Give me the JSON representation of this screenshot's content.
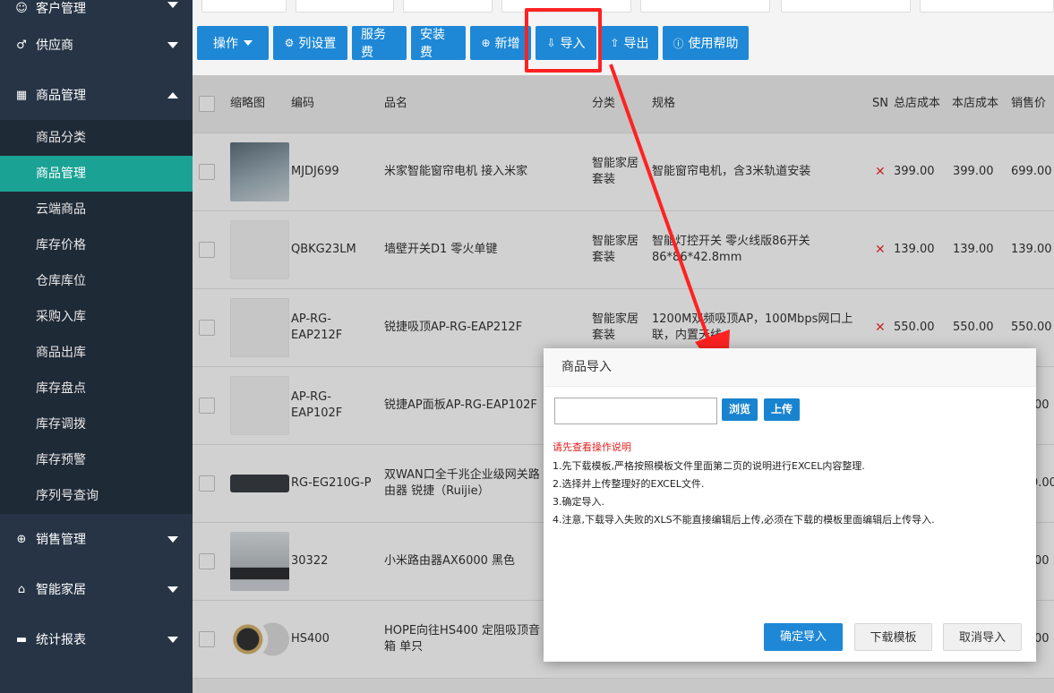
{
  "sidebar": {
    "groups_top": [
      {
        "label": "客户管理",
        "icon": "users-icon"
      },
      {
        "label": "供应商",
        "icon": "supplier-icon"
      }
    ],
    "goods": {
      "label": "商品管理",
      "icon": "gift-icon"
    },
    "sub_items": [
      "商品分类",
      "商品管理",
      "云端商品",
      "库存价格",
      "仓库库位",
      "采购入库",
      "商品出库",
      "库存盘点",
      "库存调拨",
      "库存预警",
      "序列号查询"
    ],
    "groups_bottom": [
      {
        "label": "销售管理",
        "icon": "cart-icon"
      },
      {
        "label": "智能家居",
        "icon": "home-icon"
      },
      {
        "label": "统计报表",
        "icon": "report-icon"
      }
    ]
  },
  "toolbar": {
    "operate": "操作",
    "columns": "列设置",
    "service_fee": "服务费",
    "install_fee": "安装费",
    "add": "新增",
    "import": "导入",
    "export": "导出",
    "help": "使用帮助"
  },
  "table": {
    "headers": {
      "thumb": "缩略图",
      "code": "编码",
      "name": "品名",
      "category": "分类",
      "spec": "规格",
      "sn": "SN",
      "total_cost": "总店成本",
      "store_cost": "本店成本",
      "price": "销售价"
    },
    "rows": [
      {
        "code": "MJDJ699",
        "name": "米家智能窗帘电机 接入米家",
        "category": "智能家居套装",
        "spec": "智能窗帘电机，含3米轨道安装",
        "sn": "✕",
        "total_cost": "399.00",
        "store_cost": "399.00",
        "price": "699.00"
      },
      {
        "code": "QBKG23LM",
        "name": "墙壁开关D1 零火单键",
        "category": "智能家居套装",
        "spec": "智能灯控开关 零火线版86开关 86*86*42.8mm",
        "sn": "✕",
        "total_cost": "139.00",
        "store_cost": "139.00",
        "price": "139.00"
      },
      {
        "code": "AP-RG-EAP212F",
        "name": "锐捷吸顶AP-RG-EAP212F",
        "category": "智能家居套装",
        "spec": "1200M双频吸顶AP，100Mbps网口上联，内置天线",
        "sn": "✕",
        "total_cost": "550.00",
        "store_cost": "550.00",
        "price": "550.00"
      },
      {
        "code": "AP-RG-EAP102F",
        "name": "锐捷AP面板AP-RG-EAP102F",
        "category": "",
        "spec": "",
        "sn": "",
        "total_cost": "",
        "store_cost": "",
        "price": "00"
      },
      {
        "code": "RG-EG210G-P",
        "name": "双WAN口全千兆企业级网关路由器 锐捷（Ruijie）",
        "category": "",
        "spec": "",
        "sn": "",
        "total_cost": "",
        "store_cost": "",
        "price": "9.00"
      },
      {
        "code": "30322",
        "name": "小米路由器AX6000 黑色",
        "category": "",
        "spec": "",
        "sn": "",
        "total_cost": "",
        "store_cost": "",
        "price": "00"
      },
      {
        "code": "HS400",
        "name": "HOPE向往HS400 定阻吸顶音箱 单只",
        "category": "",
        "spec": "",
        "sn": "",
        "total_cost": "",
        "store_cost": "",
        "price": "00"
      }
    ]
  },
  "dialog": {
    "title": "商品导入",
    "browse": "浏览",
    "upload": "上传",
    "file_value": "",
    "instr_title": "请先查看操作说明",
    "instructions": [
      "1.先下载模板,严格按照模板文件里面第二页的说明进行EXCEL内容整理.",
      "2.选择并上传整理好的EXCEL文件.",
      "3.确定导入.",
      "4.注意,下载导入失败的XLS不能直接编辑后上传,必须在下载的模板里面编辑后上传导入."
    ],
    "confirm": "确定导入",
    "download": "下载模板",
    "cancel": "取消导入"
  },
  "colors": {
    "sidebar_bg": "#263445",
    "active_teal": "#1aa394",
    "button_blue": "#1e88d6",
    "annotation_red": "#f22"
  }
}
